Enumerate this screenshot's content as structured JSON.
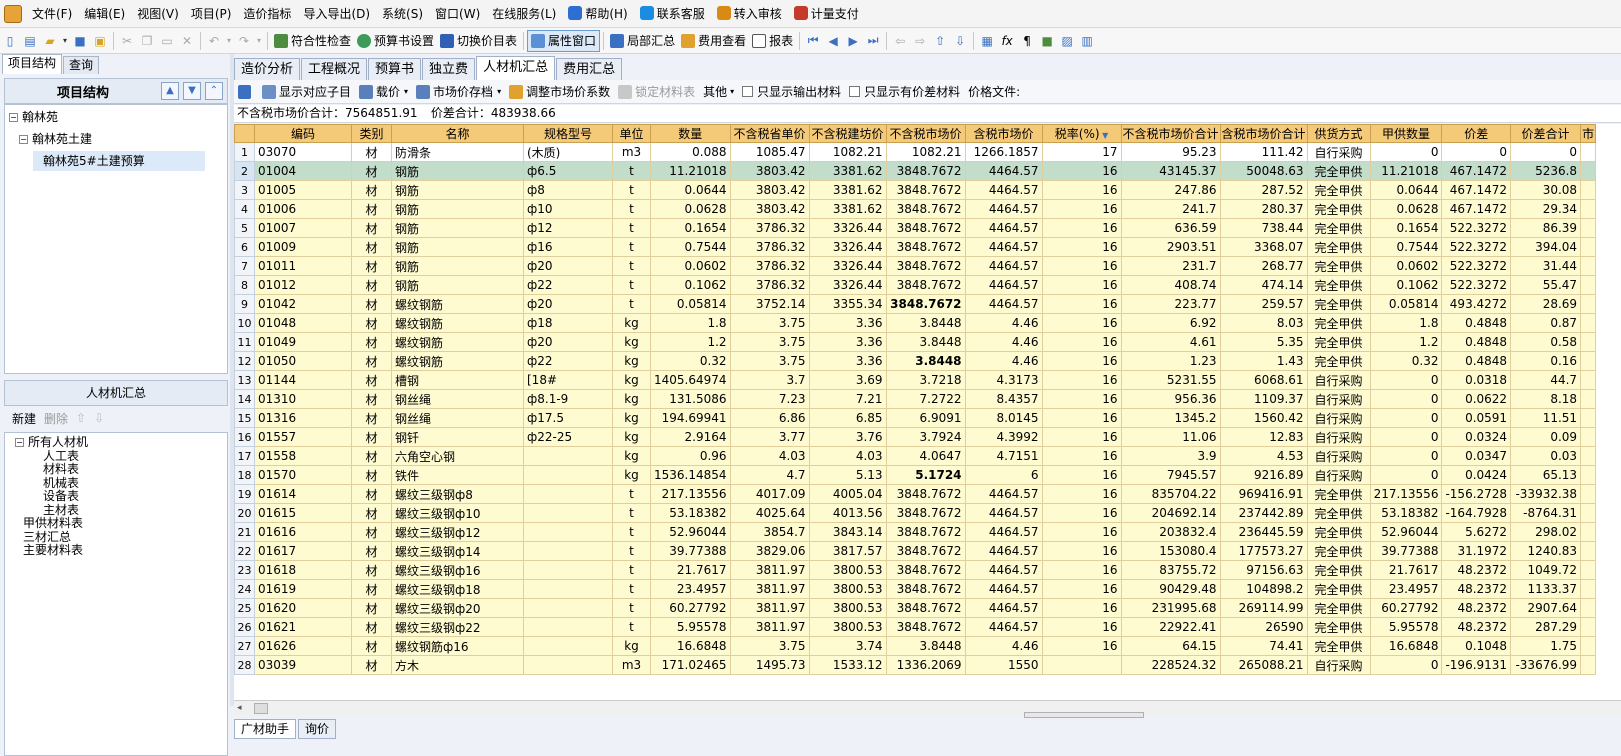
{
  "menu": [
    "文件(F)",
    "编辑(E)",
    "视图(V)",
    "项目(P)",
    "造价指标",
    "导入导出(D)",
    "系统(S)",
    "窗口(W)",
    "在线服务(L)"
  ],
  "menu_extra": [
    {
      "label": "帮助(H)",
      "color": "#2c6fd1"
    },
    {
      "label": "联系客服",
      "color": "#1a8de0"
    },
    {
      "label": "转入审核",
      "color": "#d98a14"
    },
    {
      "label": "计量支付",
      "color": "#c43b2b"
    }
  ],
  "toolbar": {
    "check": "符合性检查",
    "book_settings": "预算书设置",
    "switch_price": "切换价目表",
    "property_window": "属性窗口",
    "local_summary": "局部汇总",
    "fee_view": "费用查看",
    "report": "报表"
  },
  "left": {
    "tabs": [
      "项目结构",
      "查询"
    ],
    "header": "项目结构",
    "tree": [
      "翰林苑",
      "翰林苑土建",
      "翰林苑5#土建预算"
    ],
    "summary_header": "人材机汇总",
    "new": "新建",
    "delete": "删除",
    "tree2": [
      {
        "label": "所有人材机",
        "level": 0
      },
      {
        "label": "人工表",
        "level": 2
      },
      {
        "label": "材料表",
        "level": 2
      },
      {
        "label": "机械表",
        "level": 2
      },
      {
        "label": "设备表",
        "level": 2
      },
      {
        "label": "主材表",
        "level": 2
      },
      {
        "label": "甲供材料表",
        "level": 1
      },
      {
        "label": "三材汇总",
        "level": 1
      },
      {
        "label": "主要材料表",
        "level": 1
      }
    ]
  },
  "main_tabs": [
    "造价分析",
    "工程概况",
    "预算书",
    "独立费",
    "人材机汇总",
    "费用汇总"
  ],
  "sub_toolbar": {
    "show_children": "显示对应子目",
    "price_load": "载价",
    "market_archive": "市场价存档",
    "adjust_coef": "调整市场价系数",
    "lock_material": "锁定材料表",
    "other": "其他",
    "only_output": "只显示输出材料",
    "only_diff": "只显示有价差材料",
    "price_file": "价格文件:"
  },
  "info": {
    "market_total": "不含税市场价合计：7564851.91",
    "diff_total": "价差合计：483938.66"
  },
  "grid": {
    "columns": [
      "编码",
      "类别",
      "名称",
      "规格型号",
      "单位",
      "数量",
      "不含税省单价",
      "不含税建坊价",
      "不含税市场价",
      "含税市场价",
      "税率(%)",
      "不含税市场价合计",
      "含税市场价合计",
      "供货方式",
      "甲供数量",
      "价差",
      "价差合计",
      "市"
    ],
    "rows": [
      [
        "1",
        "03070",
        "材",
        "防滑条",
        "(木质)",
        "m3",
        "0.088",
        "1085.47",
        "1082.21",
        "1082.21",
        "1266.1857",
        "17",
        "95.23",
        "111.42",
        "自行采购",
        "0",
        "0",
        "0"
      ],
      [
        "2",
        "01004",
        "材",
        "钢筋",
        "ф6.5",
        "t",
        "11.21018",
        "3803.42",
        "3381.62",
        "3848.7672",
        "4464.57",
        "16",
        "43145.37",
        "50048.63",
        "完全甲供",
        "11.21018",
        "467.1472",
        "5236.8"
      ],
      [
        "3",
        "01005",
        "材",
        "钢筋",
        "ф8",
        "t",
        "0.0644",
        "3803.42",
        "3381.62",
        "3848.7672",
        "4464.57",
        "16",
        "247.86",
        "287.52",
        "完全甲供",
        "0.0644",
        "467.1472",
        "30.08"
      ],
      [
        "4",
        "01006",
        "材",
        "钢筋",
        "ф10",
        "t",
        "0.0628",
        "3803.42",
        "3381.62",
        "3848.7672",
        "4464.57",
        "16",
        "241.7",
        "280.37",
        "完全甲供",
        "0.0628",
        "467.1472",
        "29.34"
      ],
      [
        "5",
        "01007",
        "材",
        "钢筋",
        "ф12",
        "t",
        "0.1654",
        "3786.32",
        "3326.44",
        "3848.7672",
        "4464.57",
        "16",
        "636.59",
        "738.44",
        "完全甲供",
        "0.1654",
        "522.3272",
        "86.39"
      ],
      [
        "6",
        "01009",
        "材",
        "钢筋",
        "ф16",
        "t",
        "0.7544",
        "3786.32",
        "3326.44",
        "3848.7672",
        "4464.57",
        "16",
        "2903.51",
        "3368.07",
        "完全甲供",
        "0.7544",
        "522.3272",
        "394.04"
      ],
      [
        "7",
        "01011",
        "材",
        "钢筋",
        "ф20",
        "t",
        "0.0602",
        "3786.32",
        "3326.44",
        "3848.7672",
        "4464.57",
        "16",
        "231.7",
        "268.77",
        "完全甲供",
        "0.0602",
        "522.3272",
        "31.44"
      ],
      [
        "8",
        "01012",
        "材",
        "钢筋",
        "ф22",
        "t",
        "0.1062",
        "3786.32",
        "3326.44",
        "3848.7672",
        "4464.57",
        "16",
        "408.74",
        "474.14",
        "完全甲供",
        "0.1062",
        "522.3272",
        "55.47"
      ],
      [
        "9",
        "01042",
        "材",
        "螺纹钢筋",
        "ф20",
        "t",
        "0.05814",
        "3752.14",
        "3355.34",
        "3848.7672",
        "4464.57",
        "16",
        "223.77",
        "259.57",
        "完全甲供",
        "0.05814",
        "493.4272",
        "28.69"
      ],
      [
        "10",
        "01048",
        "材",
        "螺纹钢筋",
        "ф18",
        "kg",
        "1.8",
        "3.75",
        "3.36",
        "3.8448",
        "4.46",
        "16",
        "6.92",
        "8.03",
        "完全甲供",
        "1.8",
        "0.4848",
        "0.87"
      ],
      [
        "11",
        "01049",
        "材",
        "螺纹钢筋",
        "ф20",
        "kg",
        "1.2",
        "3.75",
        "3.36",
        "3.8448",
        "4.46",
        "16",
        "4.61",
        "5.35",
        "完全甲供",
        "1.2",
        "0.4848",
        "0.58"
      ],
      [
        "12",
        "01050",
        "材",
        "螺纹钢筋",
        "ф22",
        "kg",
        "0.32",
        "3.75",
        "3.36",
        "3.8448",
        "4.46",
        "16",
        "1.23",
        "1.43",
        "完全甲供",
        "0.32",
        "0.4848",
        "0.16"
      ],
      [
        "13",
        "01144",
        "材",
        "槽钢",
        "[18#",
        "kg",
        "1405.64974",
        "3.7",
        "3.69",
        "3.7218",
        "4.3173",
        "16",
        "5231.55",
        "6068.61",
        "自行采购",
        "0",
        "0.0318",
        "44.7"
      ],
      [
        "14",
        "01310",
        "材",
        "钢丝绳",
        "ф8.1-9",
        "kg",
        "131.5086",
        "7.23",
        "7.21",
        "7.2722",
        "8.4357",
        "16",
        "956.36",
        "1109.37",
        "自行采购",
        "0",
        "0.0622",
        "8.18"
      ],
      [
        "15",
        "01316",
        "材",
        "钢丝绳",
        "ф17.5",
        "kg",
        "194.69941",
        "6.86",
        "6.85",
        "6.9091",
        "8.0145",
        "16",
        "1345.2",
        "1560.42",
        "自行采购",
        "0",
        "0.0591",
        "11.51"
      ],
      [
        "16",
        "01557",
        "材",
        "钢钎",
        "ф22-25",
        "kg",
        "2.9164",
        "3.77",
        "3.76",
        "3.7924",
        "4.3992",
        "16",
        "11.06",
        "12.83",
        "自行采购",
        "0",
        "0.0324",
        "0.09"
      ],
      [
        "17",
        "01558",
        "材",
        "六角空心钢",
        "",
        "kg",
        "0.96",
        "4.03",
        "4.03",
        "4.0647",
        "4.7151",
        "16",
        "3.9",
        "4.53",
        "自行采购",
        "0",
        "0.0347",
        "0.03"
      ],
      [
        "18",
        "01570",
        "材",
        "铁件",
        "",
        "kg",
        "1536.14854",
        "4.7",
        "5.13",
        "5.1724",
        "6",
        "16",
        "7945.57",
        "9216.89",
        "自行采购",
        "0",
        "0.0424",
        "65.13"
      ],
      [
        "19",
        "01614",
        "材",
        "螺纹三级钢ф8",
        "",
        "t",
        "217.13556",
        "4017.09",
        "4005.04",
        "3848.7672",
        "4464.57",
        "16",
        "835704.22",
        "969416.91",
        "完全甲供",
        "217.13556",
        "-156.2728",
        "-33932.38"
      ],
      [
        "20",
        "01615",
        "材",
        "螺纹三级钢ф10",
        "",
        "t",
        "53.18382",
        "4025.64",
        "4013.56",
        "3848.7672",
        "4464.57",
        "16",
        "204692.14",
        "237442.89",
        "完全甲供",
        "53.18382",
        "-164.7928",
        "-8764.31"
      ],
      [
        "21",
        "01616",
        "材",
        "螺纹三级钢ф12",
        "",
        "t",
        "52.96044",
        "3854.7",
        "3843.14",
        "3848.7672",
        "4464.57",
        "16",
        "203832.4",
        "236445.59",
        "完全甲供",
        "52.96044",
        "5.6272",
        "298.02"
      ],
      [
        "22",
        "01617",
        "材",
        "螺纹三级钢ф14",
        "",
        "t",
        "39.77388",
        "3829.06",
        "3817.57",
        "3848.7672",
        "4464.57",
        "16",
        "153080.4",
        "177573.27",
        "完全甲供",
        "39.77388",
        "31.1972",
        "1240.83"
      ],
      [
        "23",
        "01618",
        "材",
        "螺纹三级钢ф16",
        "",
        "t",
        "21.7617",
        "3811.97",
        "3800.53",
        "3848.7672",
        "4464.57",
        "16",
        "83755.72",
        "97156.63",
        "完全甲供",
        "21.7617",
        "48.2372",
        "1049.72"
      ],
      [
        "24",
        "01619",
        "材",
        "螺纹三级钢ф18",
        "",
        "t",
        "23.4957",
        "3811.97",
        "3800.53",
        "3848.7672",
        "4464.57",
        "16",
        "90429.48",
        "104898.2",
        "完全甲供",
        "23.4957",
        "48.2372",
        "1133.37"
      ],
      [
        "25",
        "01620",
        "材",
        "螺纹三级钢ф20",
        "",
        "t",
        "60.27792",
        "3811.97",
        "3800.53",
        "3848.7672",
        "4464.57",
        "16",
        "231995.68",
        "269114.99",
        "完全甲供",
        "60.27792",
        "48.2372",
        "2907.64"
      ],
      [
        "26",
        "01621",
        "材",
        "螺纹三级钢ф22",
        "",
        "t",
        "5.95578",
        "3811.97",
        "3800.53",
        "3848.7672",
        "4464.57",
        "16",
        "22922.41",
        "26590",
        "完全甲供",
        "5.95578",
        "48.2372",
        "287.29"
      ],
      [
        "27",
        "01626",
        "材",
        "螺纹钢筋ф16",
        "",
        "kg",
        "16.6848",
        "3.75",
        "3.74",
        "3.8448",
        "4.46",
        "16",
        "64.15",
        "74.41",
        "完全甲供",
        "16.6848",
        "0.1048",
        "1.75"
      ],
      [
        "28",
        "03039",
        "材",
        "方木",
        "",
        "m3",
        "171.02465",
        "1495.73",
        "1533.12",
        "1336.2069",
        "1550",
        "",
        "228524.32",
        "265088.21",
        "自行采购",
        "0",
        "-196.9131",
        "-33676.99"
      ]
    ]
  },
  "bottom_tabs": [
    "广材助手",
    "询价"
  ]
}
